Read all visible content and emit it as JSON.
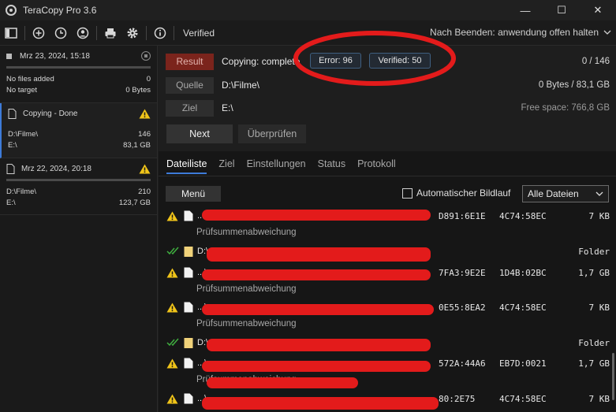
{
  "window": {
    "title": "TeraCopy Pro 3.6",
    "minimize_glyph": "—",
    "maximize_glyph": "☐",
    "close_glyph": "✕"
  },
  "toolbar": {
    "icons": [
      "sidebar-toggle-icon",
      "add-icon",
      "history-icon",
      "user-icon",
      "print-icon",
      "gear-icon",
      "info-icon"
    ],
    "verified_label": "Verified",
    "after_finish_label": "Nach Beenden: anwendung offen halten"
  },
  "sidebar": {
    "jobs": [
      {
        "date": "Mrz 23, 2024, 15:18",
        "rows": [
          {
            "left": "No files added",
            "right": "0"
          },
          {
            "left": "No target",
            "right": "0 Bytes"
          }
        ]
      },
      {
        "date": "Copying - Done",
        "rows": [
          {
            "left": "D:\\Filme\\",
            "right": "146"
          },
          {
            "left": "E:\\",
            "right": "83,1 GB"
          }
        ]
      },
      {
        "date": "Mrz 22, 2024, 20:18",
        "rows": [
          {
            "left": "D:\\Filme\\",
            "right": "210"
          },
          {
            "left": "E:\\",
            "right": "123,7 GB"
          }
        ]
      }
    ]
  },
  "main": {
    "result_label": "Result",
    "copying_status": "Copying: complete",
    "error_badge": "Error: 96",
    "verified_badge": "Verified: 50",
    "count": "0 / 146",
    "source_label": "Quelle",
    "source_path": "D:\\Filme\\",
    "source_size": "0 Bytes / 83,1 GB",
    "target_label": "Ziel",
    "target_path": "E:\\",
    "free_space": "Free space: 766,8 GB",
    "next_label": "Next",
    "verify_label": "Überprüfen"
  },
  "tabs": [
    "Dateiliste",
    "Ziel",
    "Einstellungen",
    "Status",
    "Protokoll"
  ],
  "list_controls": {
    "menu_label": "Menü",
    "autoscroll_label": "Automatischer Bildlauf",
    "filter_selected": "Alle Dateien"
  },
  "files": [
    {
      "status": "warning",
      "type": "file",
      "name": "...\\",
      "hash1": "D891:6E1E",
      "hash2": "4C74:58EC",
      "size": "7 KB",
      "sub": "Prüfsummenabweichung"
    },
    {
      "status": "verified",
      "type": "folder",
      "name": "D:\\",
      "hash1": "",
      "hash2": "",
      "size": "Folder",
      "sub": ""
    },
    {
      "status": "warning",
      "type": "file",
      "name": "...\\",
      "hash1": "7FA3:9E2E",
      "hash2": "1D4B:02BC",
      "size": "1,7 GB",
      "sub": "Prüfsummenabweichung"
    },
    {
      "status": "warning",
      "type": "file",
      "name": "...\\",
      "hash1": "0E55:8EA2",
      "hash2": "4C74:58EC",
      "size": "7 KB",
      "sub": "Prüfsummenabweichung"
    },
    {
      "status": "verified",
      "type": "folder",
      "name": "D:\\",
      "hash1": "",
      "hash2": "",
      "size": "Folder",
      "sub": ""
    },
    {
      "status": "warning",
      "type": "file",
      "name": "...\\",
      "hash1": "572A:44A6",
      "hash2": "EB7D:0021",
      "size": "1,7 GB",
      "sub": "Prüfsummenabweichung"
    },
    {
      "status": "warning",
      "type": "file",
      "name": "...\\",
      "hash1": "80:2E75",
      "hash2": "4C74:58EC",
      "size": "7 KB",
      "sub": ""
    }
  ],
  "colors": {
    "accent": "#3d7bd9",
    "warning": "#f0c419",
    "verified": "#3fae3f",
    "result": "#7b241c",
    "annotation": "#e31b1b"
  }
}
